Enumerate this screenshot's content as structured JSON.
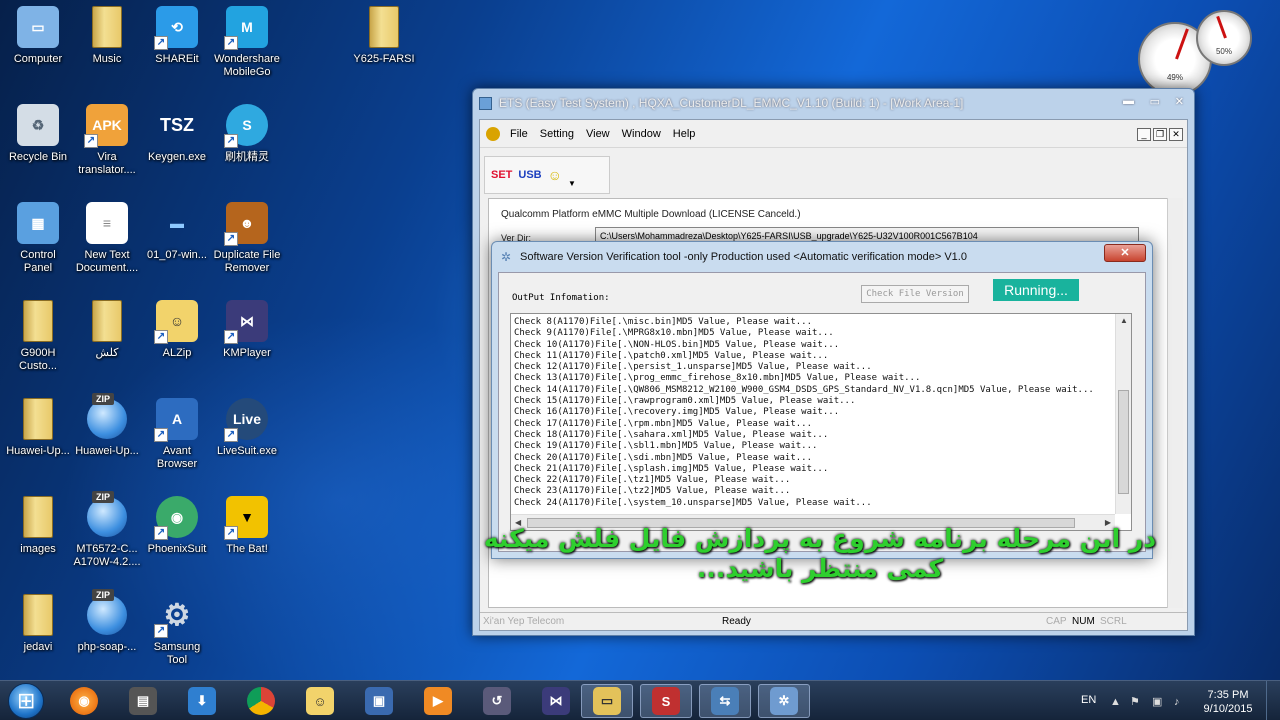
{
  "desktop": {
    "icons": [
      {
        "label": "Computer",
        "icon": "computer-icon"
      },
      {
        "label": "Music",
        "icon": "folder-icon"
      },
      {
        "label": "SHAREit",
        "icon": "shareit-icon"
      },
      {
        "label": "Wondershare\nMobileGo",
        "icon": "mobilego-icon"
      },
      {
        "label": "Y625-FARSI",
        "icon": "folder-icon"
      },
      {
        "label": "Recycle Bin",
        "icon": "recycle-bin-icon"
      },
      {
        "label": "Vira\ntranslator....",
        "icon": "apk-icon"
      },
      {
        "label": "Keygen.exe",
        "icon": "keygen-icon"
      },
      {
        "label": "刷机精灵",
        "icon": "flash-wizard-icon"
      },
      {
        "label": "Control\nPanel",
        "icon": "control-panel-icon"
      },
      {
        "label": "New Text\nDocument....",
        "icon": "text-document-icon"
      },
      {
        "label": "01_07-win...",
        "icon": "media-file-icon"
      },
      {
        "label": "Duplicate File\nRemover",
        "icon": "duplicate-remover-icon"
      },
      {
        "label": "G900H\nCusto...",
        "icon": "folder-icon"
      },
      {
        "label": "کلش",
        "icon": "folder-icon"
      },
      {
        "label": "ALZip",
        "icon": "alzip-icon"
      },
      {
        "label": "KMPlayer",
        "icon": "kmplayer-icon"
      },
      {
        "label": "Huawei-Up...",
        "icon": "folder-icon"
      },
      {
        "label": "Huawei-Up...",
        "icon": "zip-icon"
      },
      {
        "label": "Avant\nBrowser",
        "icon": "avant-browser-icon"
      },
      {
        "label": "LiveSuit.exe",
        "icon": "livesuit-icon"
      },
      {
        "label": "images",
        "icon": "folder-icon"
      },
      {
        "label": "MT6572-C...\nA170W-4.2....",
        "icon": "zip-icon"
      },
      {
        "label": "PhoenixSuit",
        "icon": "phoenixsuit-icon"
      },
      {
        "label": "The Bat!",
        "icon": "the-bat-icon"
      },
      {
        "label": "jedavi",
        "icon": "folder-icon"
      },
      {
        "label": "php-soap-...",
        "icon": "zip-icon"
      },
      {
        "label": "Samsung\nTool",
        "icon": "samsung-tool-icon"
      }
    ]
  },
  "gadget": {
    "cpu_percent": "49%",
    "memory_percent": "50%"
  },
  "ets_window": {
    "title": "ETS (Easy Test System) , HQXA_CustomerDL_EMMC_V1.10 (Build: 1) - [Work Area-1]",
    "menu": [
      "File",
      "Setting",
      "View",
      "Window",
      "Help"
    ],
    "toolbar": {
      "set_label": "SET",
      "usb_label": "USB"
    },
    "platform_text": "Qualcomm Platform eMMC Multiple Download (LICENSE Canceld.)",
    "ver_dir_label": "Ver Dir:",
    "ver_dir_value": "C:\\Users\\Mohammadreza\\Desktop\\Y625-FARSI\\USB_upgrade\\Y625-U32V100R001C567B104",
    "status": {
      "left": "Xi'an Yep Telecom",
      "middle": "Ready",
      "cap": "CAP",
      "num": "NUM",
      "scrl": "SCRL"
    }
  },
  "verify_dialog": {
    "title": "Software Version Verification tool -only Production used  <Automatic verification mode> V1.0",
    "output_label": "OutPut Infomation:",
    "check_button": "Check File Version",
    "running_label": "Running...",
    "log_lines": [
      "Check 8(A1170)File[.\\misc.bin]MD5 Value, Please wait...",
      "Check 9(A1170)File[.\\MPRG8x10.mbn]MD5 Value, Please wait...",
      "Check 10(A1170)File[.\\NON-HLOS.bin]MD5 Value, Please wait...",
      "Check 11(A1170)File[.\\patch0.xml]MD5 Value, Please wait...",
      "Check 12(A1170)File[.\\persist_1.unsparse]MD5 Value, Please wait...",
      "Check 13(A1170)File[.\\prog_emmc_firehose_8x10.mbn]MD5 Value, Please wait...",
      "Check 14(A1170)File[.\\QW806_MSM8212_W2100_W900_GSM4_DSDS_GPS_Standard_NV_V1.8.qcn]MD5 Value, Please wait...",
      "Check 15(A1170)File[.\\rawprogram0.xml]MD5 Value, Please wait...",
      "Check 16(A1170)File[.\\recovery.img]MD5 Value, Please wait...",
      "Check 17(A1170)File[.\\rpm.mbn]MD5 Value, Please wait...",
      "Check 18(A1170)File[.\\sahara.xml]MD5 Value, Please wait...",
      "Check 19(A1170)File[.\\sbl1.mbn]MD5 Value, Please wait...",
      "Check 20(A1170)File[.\\sdi.mbn]MD5 Value, Please wait...",
      "Check 21(A1170)File[.\\splash.img]MD5 Value, Please wait...",
      "Check 22(A1170)File[.\\tz1]MD5 Value, Please wait...",
      "Check 23(A1170)File[.\\tz2]MD5 Value, Please wait...",
      "Check 24(A1170)File[.\\system_10.unsparse]MD5 Value, Please wait..."
    ]
  },
  "caption": {
    "line1": "در این مرحله برنامه شروع به پردازش فایل فلش میکنه",
    "line2": "کمی منتظر باشید..."
  },
  "taskbar": {
    "language": "EN",
    "time": "7:35 PM",
    "date": "9/10/2015"
  }
}
